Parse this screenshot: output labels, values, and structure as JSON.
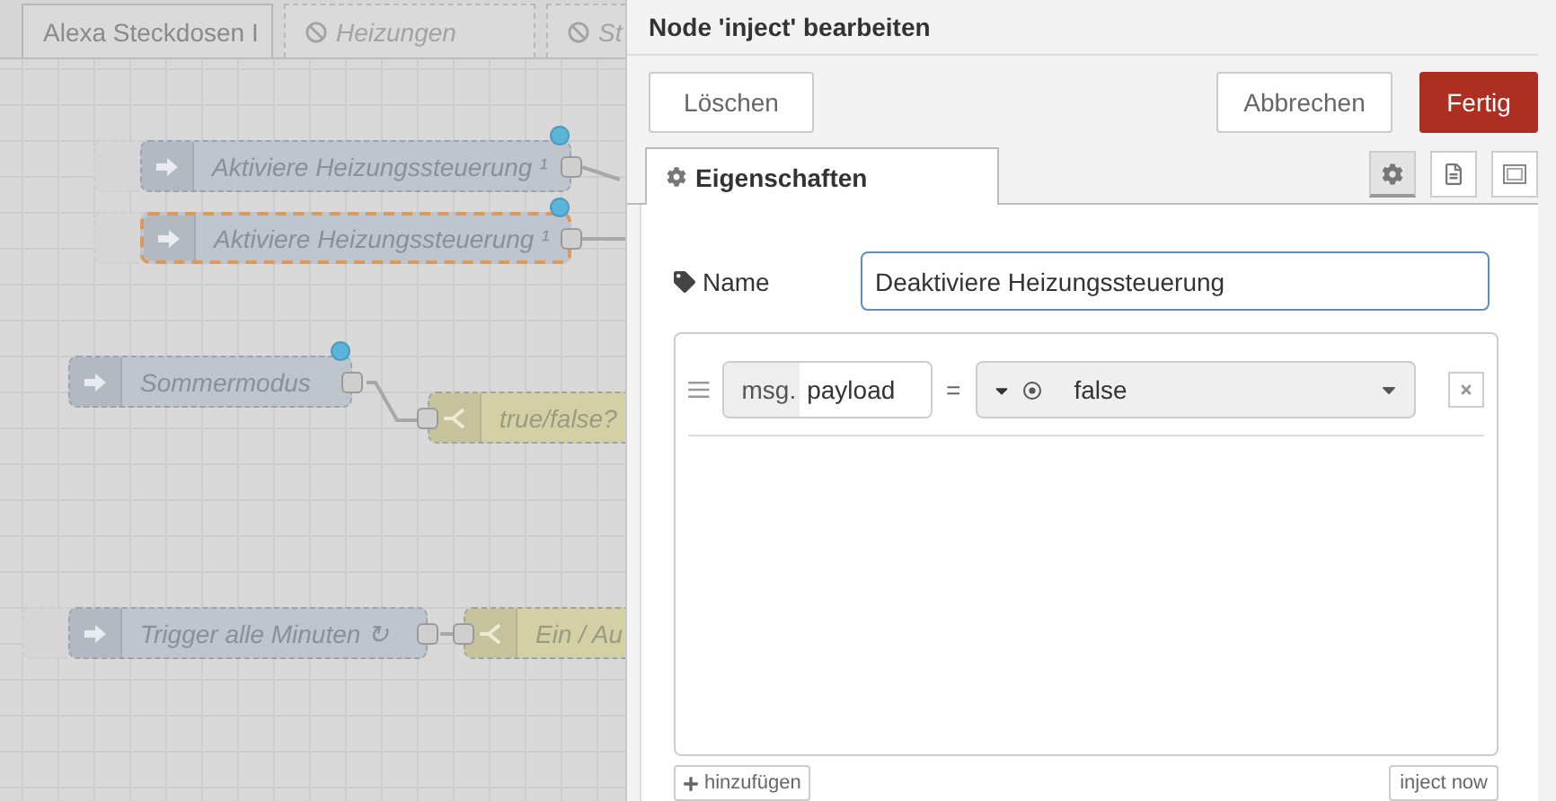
{
  "flow_tabs": [
    {
      "label": "Alexa Steckdosen I",
      "disabled": false
    },
    {
      "label": "Heizungen",
      "disabled": true
    },
    {
      "label": "St",
      "disabled": true
    }
  ],
  "nodes": [
    {
      "kind": "inject",
      "label": "Aktiviere Heizungssteuerung ¹",
      "button": true,
      "changed": true,
      "selected": false
    },
    {
      "kind": "inject",
      "label": "Aktiviere Heizungssteuerung ¹",
      "button": true,
      "changed": true,
      "selected": true
    },
    {
      "kind": "inject",
      "label": "Sommermodus",
      "button": false,
      "changed": true,
      "selected": false
    },
    {
      "kind": "switch",
      "label": "true/false?",
      "button": false,
      "changed": false,
      "selected": false
    },
    {
      "kind": "inject",
      "label": "Trigger alle Minuten ↻",
      "button": true,
      "changed": false,
      "selected": false
    },
    {
      "kind": "switch",
      "label": "Ein / Au",
      "button": false,
      "changed": false,
      "selected": false
    }
  ],
  "editor": {
    "title": "Node 'inject' bearbeiten",
    "delete_button": "Löschen",
    "cancel_button": "Abbrechen",
    "done_button": "Fertig",
    "tabs": [
      {
        "label": "Eigenschaften",
        "selected": true
      }
    ],
    "view_buttons": [
      {
        "kind": "settings",
        "selected": true
      },
      {
        "kind": "description",
        "selected": false
      },
      {
        "kind": "appearance",
        "selected": false
      }
    ],
    "name_label": "Name",
    "name_value": "Deaktiviere Heizungssteuerung",
    "properties": [
      {
        "prefix": "msg.",
        "property": "payload",
        "operator": "=",
        "kind": "boolean",
        "value": "false"
      }
    ],
    "add_button": "hinzufügen",
    "inject_button": "inject now"
  }
}
